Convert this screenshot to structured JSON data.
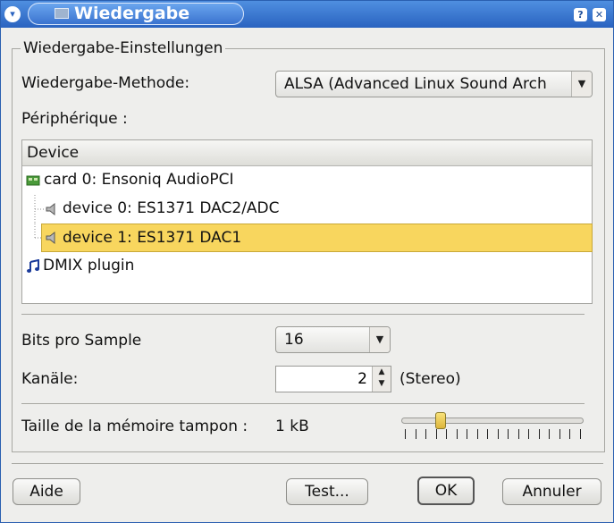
{
  "window": {
    "title": "Wiedergabe",
    "help_button": "?",
    "close_button": "✕",
    "menu_button": "▾"
  },
  "group": {
    "title": "Wiedergabe-Einstellungen",
    "method_label": "Wiedergabe-Methode:",
    "method_value": "ALSA (Advanced Linux Sound Arch",
    "device_label": "Périphérique :"
  },
  "device_list": {
    "header": "Device",
    "items": [
      {
        "label": "card 0: Ensoniq AudioPCI",
        "icon": "sound-card-icon",
        "level": 0,
        "selected": false
      },
      {
        "label": "device 0: ES1371 DAC2/ADC",
        "icon": "speaker-icon",
        "level": 1,
        "selected": false
      },
      {
        "label": "device 1: ES1371 DAC1",
        "icon": "speaker-icon",
        "level": 1,
        "selected": true
      },
      {
        "label": "DMIX plugin",
        "icon": "music-note-icon",
        "level": 0,
        "selected": false
      }
    ]
  },
  "bits": {
    "label": "Bits pro Sample",
    "value": "16"
  },
  "channels": {
    "label": "Kanäle:",
    "value": "2",
    "mode": "(Stereo)"
  },
  "buffer": {
    "label": "Taille de la mémoire tampon :",
    "value": "1 kB",
    "slider_fraction": 0.2,
    "tick_count": 18
  },
  "buttons": {
    "help": "Aide",
    "test": "Test...",
    "ok": "OK",
    "cancel": "Annuler"
  },
  "colors": {
    "titlebar": "#2a63c0",
    "selection": "#f8d65e"
  }
}
